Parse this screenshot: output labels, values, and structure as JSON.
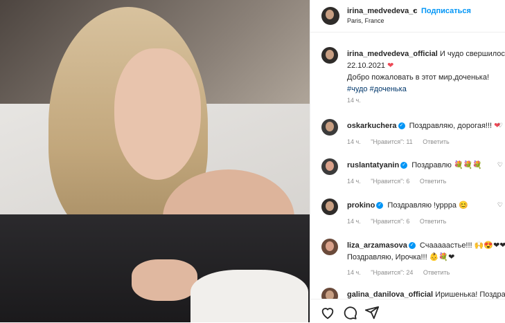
{
  "post": {
    "author": "irina_medvedeva_c",
    "separator": "•",
    "follow_label": "Подписаться",
    "location": "Paris, France"
  },
  "caption": {
    "author": "irina_medvedeva_official",
    "text1": "И чудо свершилось",
    "date": "22.10.2021",
    "text2": "Добро пожаловать в этот мир,доченька!",
    "tags": "#чудо #доченька",
    "time": "14 ч."
  },
  "comments": [
    {
      "user": "oskarkuchera",
      "text": "Поздравляю, дорогая!!!",
      "time": "14 ч.",
      "likes": "\"Нравится\": 11",
      "reply": "Ответить"
    },
    {
      "user": "ruslantatyanin",
      "text": "Поздравлю",
      "time": "14 ч.",
      "likes": "\"Нравится\": 6",
      "reply": "Ответить"
    },
    {
      "user": "prokino",
      "text": "Поздравляю !уррра",
      "time": "14 ч.",
      "likes": "\"Нравится\": 6",
      "reply": "Ответить"
    },
    {
      "user": "liza_arzamasova",
      "text": "Счааааастье!!!",
      "text2": "Поздравляю, Ирочка!!!",
      "time": "14 ч.",
      "likes": "\"Нравится\": 24",
      "reply": "Ответить"
    },
    {
      "user": "galina_danilova_official",
      "text": "Иришенька! Поздравляю"
    }
  ],
  "icons": {
    "heart": "heart-icon",
    "comment": "comment-icon",
    "share": "share-icon",
    "save": "bookmark-icon",
    "verified": "verified-badge-icon"
  },
  "colors": {
    "accent": "#0095f6",
    "link": "#00376b",
    "heart": "#ed4956",
    "meta": "#8e8e8e"
  }
}
